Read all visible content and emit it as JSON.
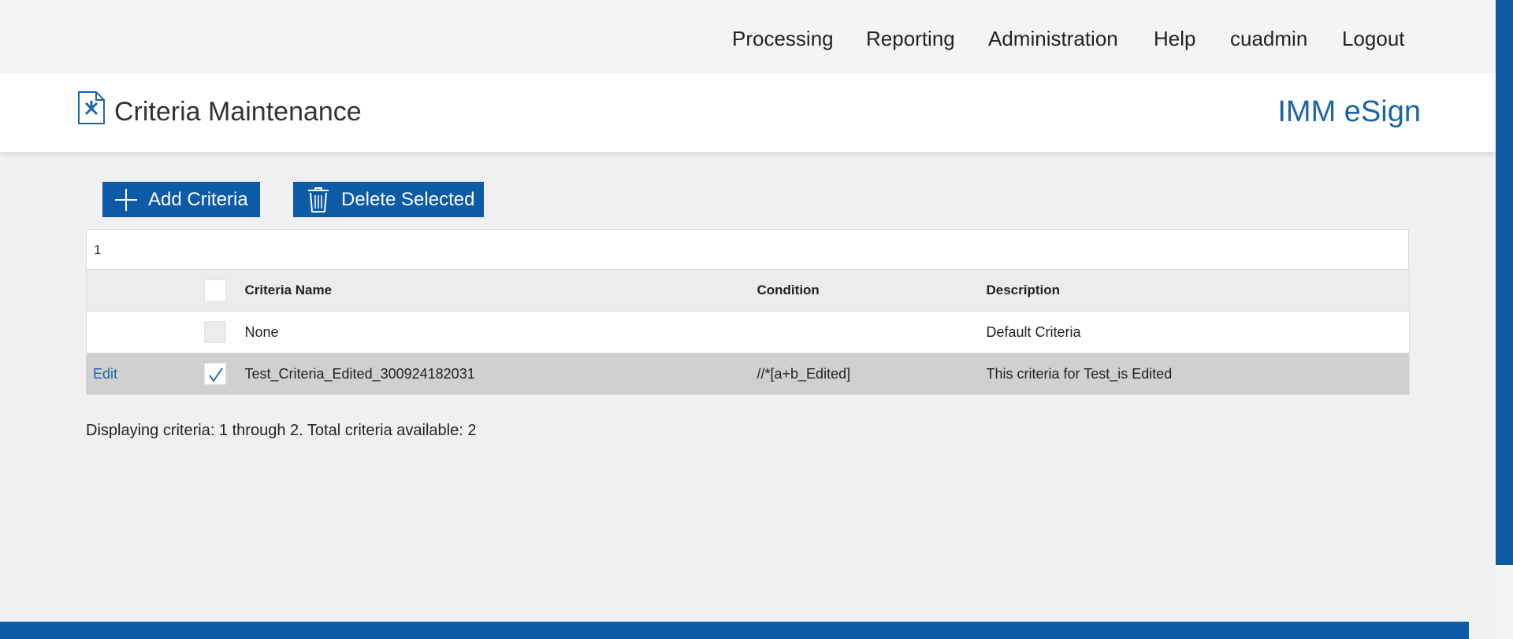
{
  "nav": {
    "items": [
      "Processing",
      "Reporting",
      "Administration",
      "Help",
      "cuadmin",
      "Logout"
    ]
  },
  "header": {
    "title": "Criteria Maintenance",
    "brand": "IMM eSign",
    "icon": "tools-document-icon"
  },
  "toolbar": {
    "add_label": "Add Criteria",
    "delete_label": "Delete Selected"
  },
  "pager": {
    "page": "1"
  },
  "table": {
    "columns": [
      "",
      "",
      "Criteria Name",
      "Condition",
      "Description"
    ],
    "rows": [
      {
        "edit": "",
        "checkbox": "disabled",
        "name": "None",
        "condition": "",
        "description": "Default Criteria"
      },
      {
        "edit": "Edit",
        "checkbox": "checked",
        "name": "Test_Criteria_Edited_300924182031",
        "condition": "//*[a+b_Edited]",
        "description": "This criteria for Test_is Edited"
      }
    ]
  },
  "summary": "Displaying criteria: 1 through 2. Total criteria available: 2",
  "colors": {
    "accent": "#0d5aa7",
    "brand_text": "#1a64a8",
    "selected_row": "#d0d0d0"
  }
}
